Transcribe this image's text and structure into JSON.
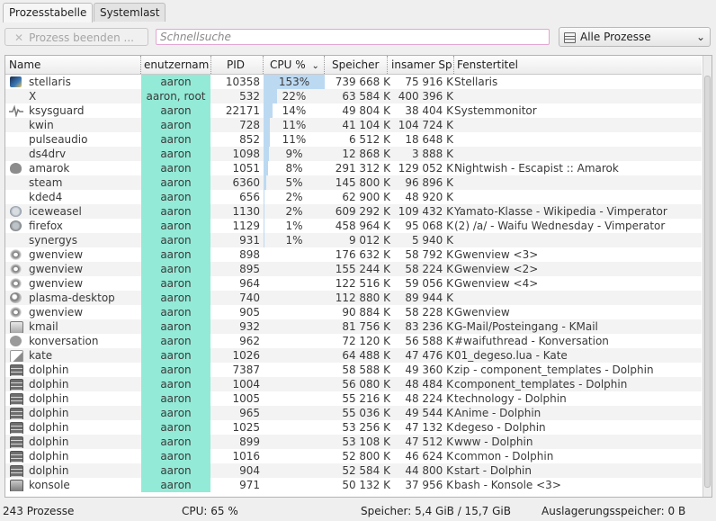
{
  "tabs": [
    {
      "label": "Prozesstabelle",
      "active": true
    },
    {
      "label": "Systemlast",
      "active": false
    }
  ],
  "toolbar": {
    "end_process_label": "Prozess beenden ...",
    "search_placeholder": "Schnellsuche",
    "filter_selected": "Alle Prozesse"
  },
  "columns": {
    "name": "Name",
    "user": "enutzernam",
    "pid": "PID",
    "cpu": "CPU %",
    "memory": "Speicher",
    "shared": "insamer Sp",
    "window_title": "Fenstertitel"
  },
  "rows": [
    {
      "icon": "stellaris-icon",
      "name": "stellaris",
      "user": "aaron",
      "pid": "10358",
      "cpu": "153%",
      "cpu_fraction": 1.0,
      "mem": "739 668 K",
      "shared": "75 916 K",
      "title": "Stellaris"
    },
    {
      "icon": "",
      "name": "X",
      "user": "aaron, root",
      "pid": "532",
      "cpu": "22%",
      "cpu_fraction": 0.22,
      "mem": "63 584 K",
      "shared": "400 396 K",
      "title": ""
    },
    {
      "icon": "ksysguard-icon",
      "name": "ksysguard",
      "user": "aaron",
      "pid": "22171",
      "cpu": "14%",
      "cpu_fraction": 0.14,
      "mem": "49 804 K",
      "shared": "38 404 K",
      "title": "Systemmonitor"
    },
    {
      "icon": "",
      "name": "kwin",
      "user": "aaron",
      "pid": "728",
      "cpu": "11%",
      "cpu_fraction": 0.11,
      "mem": "41 104 K",
      "shared": "104 724 K",
      "title": ""
    },
    {
      "icon": "",
      "name": "pulseaudio",
      "user": "aaron",
      "pid": "852",
      "cpu": "11%",
      "cpu_fraction": 0.11,
      "mem": "6 512 K",
      "shared": "18 648 K",
      "title": ""
    },
    {
      "icon": "",
      "name": "ds4drv",
      "user": "aaron",
      "pid": "1098",
      "cpu": "9%",
      "cpu_fraction": 0.09,
      "mem": "12 868 K",
      "shared": "3 888 K",
      "title": ""
    },
    {
      "icon": "amarok-icon",
      "name": "amarok",
      "user": "aaron",
      "pid": "1051",
      "cpu": "8%",
      "cpu_fraction": 0.08,
      "mem": "291 312 K",
      "shared": "129 052 K",
      "title": "Nightwish - Escapist  ::  Amarok"
    },
    {
      "icon": "",
      "name": "steam",
      "user": "aaron",
      "pid": "6360",
      "cpu": "5%",
      "cpu_fraction": 0.05,
      "mem": "145 800 K",
      "shared": "96 896 K",
      "title": ""
    },
    {
      "icon": "",
      "name": "kded4",
      "user": "aaron",
      "pid": "656",
      "cpu": "2%",
      "cpu_fraction": 0.02,
      "mem": "62 900 K",
      "shared": "48 920 K",
      "title": ""
    },
    {
      "icon": "iceweasel-icon",
      "name": "iceweasel",
      "user": "aaron",
      "pid": "1130",
      "cpu": "2%",
      "cpu_fraction": 0.02,
      "mem": "609 292 K",
      "shared": "109 432 K",
      "title": "Yamato-Klasse - Wikipedia - Vimperator"
    },
    {
      "icon": "firefox-icon",
      "name": "firefox",
      "user": "aaron",
      "pid": "1129",
      "cpu": "1%",
      "cpu_fraction": 0.01,
      "mem": "458 964 K",
      "shared": "95 068 K",
      "title": "(2) /a/ - Waifu Wednesday - Vimperator"
    },
    {
      "icon": "",
      "name": "synergys",
      "user": "aaron",
      "pid": "931",
      "cpu": "1%",
      "cpu_fraction": 0.01,
      "mem": "9 012 K",
      "shared": "5 940 K",
      "title": ""
    },
    {
      "icon": "gwenview-icon",
      "name": "gwenview",
      "user": "aaron",
      "pid": "898",
      "cpu": "",
      "cpu_fraction": 0,
      "mem": "176 632 K",
      "shared": "58 792 K",
      "title": "Gwenview <3>"
    },
    {
      "icon": "gwenview-icon",
      "name": "gwenview",
      "user": "aaron",
      "pid": "895",
      "cpu": "",
      "cpu_fraction": 0,
      "mem": "155 244 K",
      "shared": "58 224 K",
      "title": "Gwenview <2>"
    },
    {
      "icon": "gwenview-icon",
      "name": "gwenview",
      "user": "aaron",
      "pid": "964",
      "cpu": "",
      "cpu_fraction": 0,
      "mem": "122 516 K",
      "shared": "59 056 K",
      "title": "Gwenview <4>"
    },
    {
      "icon": "plasma-icon",
      "name": "plasma-desktop",
      "user": "aaron",
      "pid": "740",
      "cpu": "",
      "cpu_fraction": 0,
      "mem": "112 880 K",
      "shared": "89 944 K",
      "title": ""
    },
    {
      "icon": "gwenview-icon",
      "name": "gwenview",
      "user": "aaron",
      "pid": "905",
      "cpu": "",
      "cpu_fraction": 0,
      "mem": "90 884 K",
      "shared": "58 228 K",
      "title": "Gwenview"
    },
    {
      "icon": "kmail-icon",
      "name": "kmail",
      "user": "aaron",
      "pid": "932",
      "cpu": "",
      "cpu_fraction": 0,
      "mem": "81 756 K",
      "shared": "83 236 K",
      "title": "G-Mail/Posteingang - KMail"
    },
    {
      "icon": "konversation-icon",
      "name": "konversation",
      "user": "aaron",
      "pid": "962",
      "cpu": "",
      "cpu_fraction": 0,
      "mem": "72 120 K",
      "shared": "56 588 K",
      "title": "#waifuthread - Konversation"
    },
    {
      "icon": "kate-icon",
      "name": "kate",
      "user": "aaron",
      "pid": "1026",
      "cpu": "",
      "cpu_fraction": 0,
      "mem": "64 488 K",
      "shared": "47 476 K",
      "title": "01_degeso.lua - Kate"
    },
    {
      "icon": "dolphin-icon",
      "name": "dolphin",
      "user": "aaron",
      "pid": "7387",
      "cpu": "",
      "cpu_fraction": 0,
      "mem": "58 588 K",
      "shared": "49 360 K",
      "title": "zip - component_templates - Dolphin"
    },
    {
      "icon": "dolphin-icon",
      "name": "dolphin",
      "user": "aaron",
      "pid": "1004",
      "cpu": "",
      "cpu_fraction": 0,
      "mem": "56 080 K",
      "shared": "48 484 K",
      "title": "component_templates - Dolphin"
    },
    {
      "icon": "dolphin-icon",
      "name": "dolphin",
      "user": "aaron",
      "pid": "1005",
      "cpu": "",
      "cpu_fraction": 0,
      "mem": "55 216 K",
      "shared": "48 224 K",
      "title": "technology - Dolphin"
    },
    {
      "icon": "dolphin-icon",
      "name": "dolphin",
      "user": "aaron",
      "pid": "965",
      "cpu": "",
      "cpu_fraction": 0,
      "mem": "55 036 K",
      "shared": "49 544 K",
      "title": "Anime - Dolphin"
    },
    {
      "icon": "dolphin-icon",
      "name": "dolphin",
      "user": "aaron",
      "pid": "1025",
      "cpu": "",
      "cpu_fraction": 0,
      "mem": "53 256 K",
      "shared": "47 132 K",
      "title": "degeso - Dolphin"
    },
    {
      "icon": "dolphin-icon",
      "name": "dolphin",
      "user": "aaron",
      "pid": "899",
      "cpu": "",
      "cpu_fraction": 0,
      "mem": "53 108 K",
      "shared": "47 512 K",
      "title": "www - Dolphin"
    },
    {
      "icon": "dolphin-icon",
      "name": "dolphin",
      "user": "aaron",
      "pid": "1016",
      "cpu": "",
      "cpu_fraction": 0,
      "mem": "52 800 K",
      "shared": "46 624 K",
      "title": "common - Dolphin"
    },
    {
      "icon": "dolphin-icon",
      "name": "dolphin",
      "user": "aaron",
      "pid": "904",
      "cpu": "",
      "cpu_fraction": 0,
      "mem": "52 584 K",
      "shared": "44 800 K",
      "title": "start - Dolphin"
    },
    {
      "icon": "konsole-icon",
      "name": "konsole",
      "user": "aaron",
      "pid": "971",
      "cpu": "",
      "cpu_fraction": 0,
      "mem": "50 132 K",
      "shared": "37 956 K",
      "title": "bash - Konsole <3>"
    }
  ],
  "status": {
    "processes": "243 Prozesse",
    "cpu": "CPU: 65 %",
    "memory": "Speicher: 5,4 GiB / 15,7 GiB",
    "swap": "Auslagerungsspeicher: 0 B"
  },
  "colors": {
    "user_column": "#93ead7",
    "cpu_bar": "#bcd9f2",
    "search_border": "#e4a6d0"
  }
}
